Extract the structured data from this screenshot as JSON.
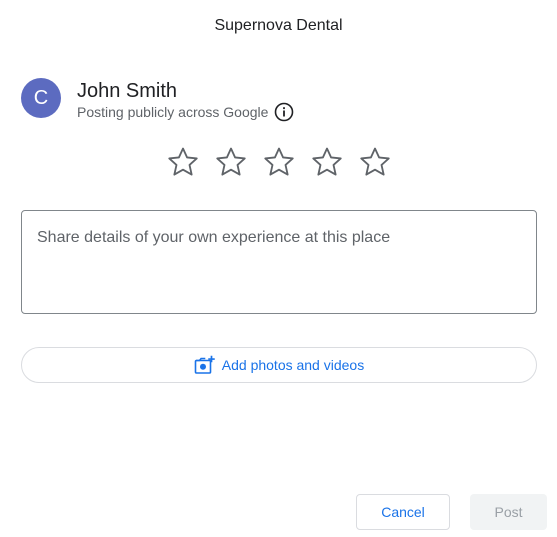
{
  "dialog": {
    "title": "Supernova Dental"
  },
  "user": {
    "avatar_letter": "C",
    "name": "John Smith",
    "posting_note": "Posting publicly across Google"
  },
  "rating": {
    "max": 5,
    "selected": 0
  },
  "review": {
    "placeholder": "Share details of your own experience at this place"
  },
  "media": {
    "label": "Add photos and videos"
  },
  "actions": {
    "cancel_label": "Cancel",
    "post_label": "Post"
  },
  "colors": {
    "accent": "#1a73e8",
    "avatar_bg": "#5c6bc0",
    "star_outline": "#5f6368"
  }
}
